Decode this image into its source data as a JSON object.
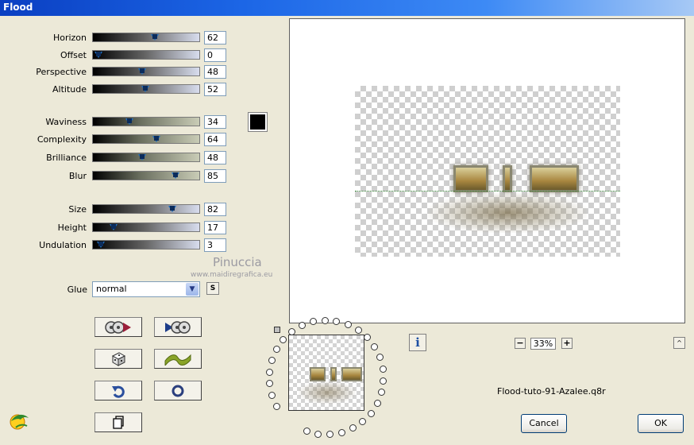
{
  "window": {
    "title": "Flood"
  },
  "sliders": [
    {
      "label": "Horizon",
      "value": "62",
      "level": 0.62
    },
    {
      "label": "Offset",
      "value": "0",
      "level": 0.0
    },
    {
      "label": "Perspective",
      "value": "48",
      "level": 0.48
    },
    {
      "label": "Altitude",
      "value": "52",
      "level": 0.52
    },
    {
      "label": "Waviness",
      "value": "34",
      "level": 0.34
    },
    {
      "label": "Complexity",
      "value": "64",
      "level": 0.64
    },
    {
      "label": "Brilliance",
      "value": "48",
      "level": 0.48
    },
    {
      "label": "Blur",
      "value": "85",
      "level": 0.85
    },
    {
      "label": "Size",
      "value": "82",
      "level": 0.82
    },
    {
      "label": "Height",
      "value": "17",
      "level": 0.17
    },
    {
      "label": "Undulation",
      "value": "3",
      "level": 0.03
    }
  ],
  "color_swatch": {
    "color": "#000000"
  },
  "glue": {
    "label": "Glue",
    "value": "normal",
    "lock_label": "S"
  },
  "tool_buttons": {
    "apply_icon": "film-reel-forward-icon",
    "reset_icon": "forward-film-reel-icon",
    "random_icon": "dice-icon",
    "wave_icon": "wave-icon",
    "undo_icon": "undo-arrow-icon",
    "ring_icon": "ring-icon",
    "copy_icon": "copy-document-icon"
  },
  "preview": {
    "zoom": "33%",
    "zoom_minus": "−",
    "zoom_plus": "+",
    "info": "i",
    "up": "^"
  },
  "filename": "Flood-tuto-91-Azalee.q8r",
  "buttons": {
    "cancel": "Cancel",
    "ok": "OK"
  },
  "watermark": {
    "name": "Pinuccia",
    "url": "www.maidiregrafica.eu"
  }
}
